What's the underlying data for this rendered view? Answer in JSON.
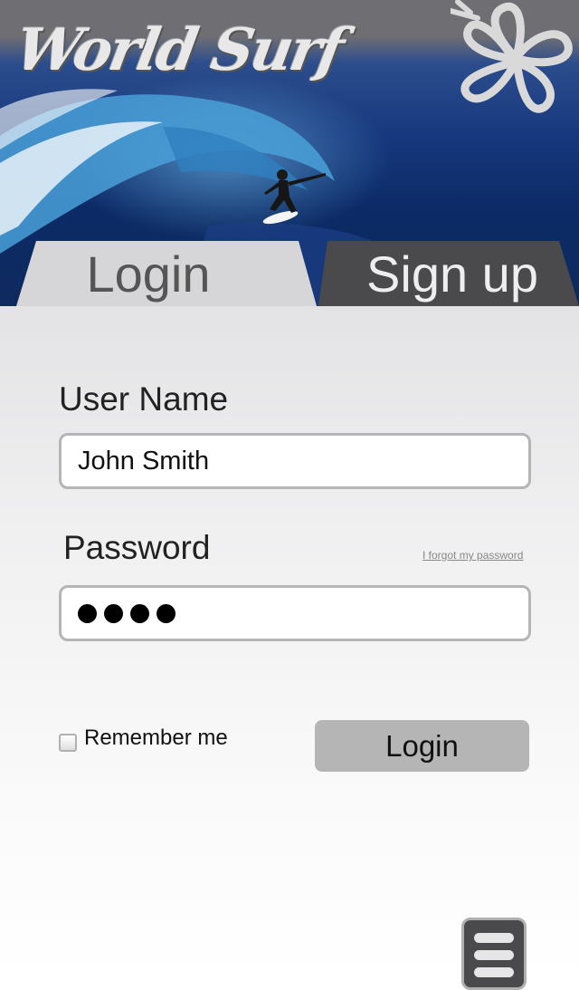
{
  "header": {
    "logo_text": "World Surf"
  },
  "tabs": {
    "login": "Login",
    "signup": "Sign up"
  },
  "form": {
    "username_label": "User Name",
    "username_value": "John Smith",
    "password_label": "Password",
    "password_masked_length": 4,
    "forgot_link": "I forgot my password",
    "remember_label": "Remember me",
    "remember_checked": false,
    "login_button": "Login"
  },
  "icons": {
    "logo": "world-surf-logo",
    "flower": "hibiscus-icon",
    "menu": "hamburger-menu-icon"
  },
  "colors": {
    "header_gray": "#6f6f73",
    "active_tab": "#d6d6d8",
    "inactive_tab": "#4a4a4d",
    "button_gray": "#b5b5b6"
  }
}
